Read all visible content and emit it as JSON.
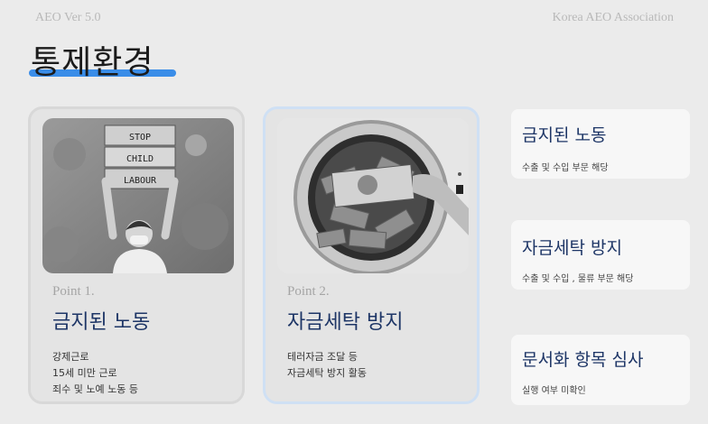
{
  "header": {
    "left": "AEO Ver 5.0",
    "right": "Korea AEO Association"
  },
  "page_title": "통제환경",
  "cards": [
    {
      "photo_signs": [
        "STOP",
        "CHILD",
        "LABOUR"
      ],
      "point": "Point 1.",
      "title": "금지된 노동",
      "lines": [
        "강제근로",
        "15세 미만 근로",
        "죄수 및 노예 노동  등"
      ]
    },
    {
      "point": "Point 2.",
      "title": "자금세탁 방지",
      "lines": [
        "테러자금 조달 등",
        "자금세탁 방지 활동"
      ]
    }
  ],
  "side_items": [
    {
      "title": "금지된 노동",
      "subtitle": "수출 및 수입 부문 해당"
    },
    {
      "title": "자금세탁 방지",
      "subtitle": "수출 및 수입 , 물류 부문 해당"
    },
    {
      "title": "문서화 항목 심사",
      "subtitle": "실행 여부 미확인"
    }
  ],
  "colors": {
    "accent": "#3a8de8",
    "title_navy": "#1d3566",
    "card2_border": "#cfe0f4"
  }
}
